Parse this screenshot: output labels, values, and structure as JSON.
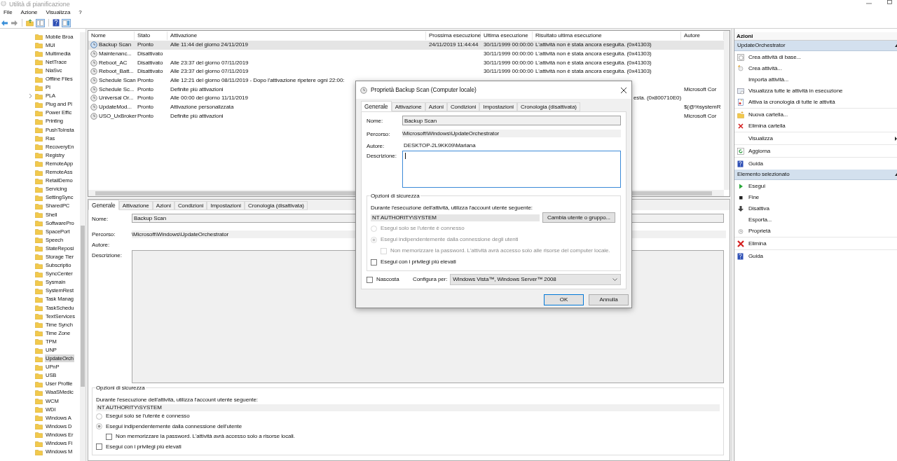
{
  "window": {
    "title": "Utilità di pianificazione"
  },
  "menu": [
    "File",
    "Azione",
    "Visualizza",
    "?"
  ],
  "tree": {
    "items": [
      {
        "label": "Mobile Broa",
        "selected": false,
        "has_children": false
      },
      {
        "label": "MUI",
        "selected": false,
        "has_children": false
      },
      {
        "label": "Multimedia",
        "selected": false,
        "has_children": false
      },
      {
        "label": "NetTrace",
        "selected": false,
        "has_children": false
      },
      {
        "label": "NlaSvc",
        "selected": false,
        "has_children": false
      },
      {
        "label": "Offline Files",
        "selected": false,
        "has_children": false
      },
      {
        "label": "PI",
        "selected": false,
        "has_children": false
      },
      {
        "label": "PLA",
        "selected": false,
        "has_children": true
      },
      {
        "label": "Plug and Pl",
        "selected": false,
        "has_children": false
      },
      {
        "label": "Power Effic",
        "selected": false,
        "has_children": false
      },
      {
        "label": "Printing",
        "selected": false,
        "has_children": false
      },
      {
        "label": "PushToInsta",
        "selected": false,
        "has_children": false
      },
      {
        "label": "Ras",
        "selected": false,
        "has_children": false
      },
      {
        "label": "RecoveryEn",
        "selected": false,
        "has_children": false
      },
      {
        "label": "Registry",
        "selected": false,
        "has_children": false
      },
      {
        "label": "RemoteApp",
        "selected": false,
        "has_children": false
      },
      {
        "label": "RemoteAss",
        "selected": false,
        "has_children": false
      },
      {
        "label": "RetailDemo",
        "selected": false,
        "has_children": false
      },
      {
        "label": "Servicing",
        "selected": false,
        "has_children": false
      },
      {
        "label": "SettingSync",
        "selected": false,
        "has_children": false
      },
      {
        "label": "SharedPC",
        "selected": false,
        "has_children": false
      },
      {
        "label": "Shell",
        "selected": false,
        "has_children": false
      },
      {
        "label": "SoftwarePro",
        "selected": false,
        "has_children": false
      },
      {
        "label": "SpacePort",
        "selected": false,
        "has_children": false
      },
      {
        "label": "Speech",
        "selected": false,
        "has_children": false
      },
      {
        "label": "StateReposi",
        "selected": false,
        "has_children": false
      },
      {
        "label": "Storage Tier",
        "selected": false,
        "has_children": false
      },
      {
        "label": "Subscriptio",
        "selected": false,
        "has_children": false
      },
      {
        "label": "SyncCenter",
        "selected": false,
        "has_children": false
      },
      {
        "label": "Sysmain",
        "selected": false,
        "has_children": false
      },
      {
        "label": "SystemRest",
        "selected": false,
        "has_children": false
      },
      {
        "label": "Task Manag",
        "selected": false,
        "has_children": false
      },
      {
        "label": "TaskSchedu",
        "selected": false,
        "has_children": false
      },
      {
        "label": "TextServices",
        "selected": false,
        "has_children": false
      },
      {
        "label": "Time Synch",
        "selected": false,
        "has_children": false
      },
      {
        "label": "Time Zone",
        "selected": false,
        "has_children": false
      },
      {
        "label": "TPM",
        "selected": false,
        "has_children": false
      },
      {
        "label": "UNP",
        "selected": false,
        "has_children": false
      },
      {
        "label": "UpdateOrch",
        "selected": true,
        "has_children": false
      },
      {
        "label": "UPnP",
        "selected": false,
        "has_children": false
      },
      {
        "label": "USB",
        "selected": false,
        "has_children": false
      },
      {
        "label": "User Profile",
        "selected": false,
        "has_children": false
      },
      {
        "label": "WaaSMedic",
        "selected": false,
        "has_children": false
      },
      {
        "label": "WCM",
        "selected": false,
        "has_children": false
      },
      {
        "label": "WDI",
        "selected": false,
        "has_children": false
      },
      {
        "label": "Windows A",
        "selected": false,
        "has_children": false
      },
      {
        "label": "Windows D",
        "selected": false,
        "has_children": false
      },
      {
        "label": "Windows Er",
        "selected": false,
        "has_children": false
      },
      {
        "label": "Windows Fi",
        "selected": false,
        "has_children": false
      },
      {
        "label": "Windows M",
        "selected": false,
        "has_children": false
      }
    ]
  },
  "task_table": {
    "columns": [
      "Nome",
      "Stato",
      "Attivazione",
      "Prossima esecuzione",
      "Ultima esecuzione",
      "Risultato ultima esecuzione",
      "Autore"
    ],
    "rows": [
      {
        "name": "Backup Scan",
        "status": "Pronto",
        "trigger": "Alle 11:44 del giorno 24/11/2019",
        "next_run": "24/11/2019 11:44:44",
        "last_run": "30/11/1999 00:00:00",
        "result": "L'attività non è stata ancora eseguita. (0x41303)",
        "selected": true
      },
      {
        "name": "Maintenanc...",
        "status": "Disattivato",
        "last_run": "30/11/1999 00:00:00",
        "result": "L'attività non è stata ancora eseguita. (0x41303)",
        "selected": false
      },
      {
        "name": "Reboot_AC",
        "status": "Disattivato",
        "trigger": "Alle 23:37 del giorno 07/11/2019",
        "last_run": "30/11/1999 00:00:00",
        "result": "L'attività non è stata ancora eseguita. (0x41303)",
        "selected": false
      },
      {
        "name": "Reboot_Batt...",
        "status": "Disattivato",
        "trigger": "Alle 23:37 del giorno 07/11/2019",
        "last_run": "30/11/1999 00:00:00",
        "result": "L'attività non è stata ancora eseguita. (0x41303)",
        "selected": false
      },
      {
        "name": "Schedule Scan",
        "status": "Pronto",
        "trigger": "Alle 12:21 del giorno 08/11/2019 - Dopo l'attivazione ripetere ogni 22:00:",
        "selected": false
      },
      {
        "name": "Schedule Sc...",
        "status": "Pronto",
        "trigger": "Definite più attivazioni",
        "author": "Microsoft Cor",
        "selected": false
      },
      {
        "name": "Universal Or...",
        "status": "Pronto",
        "trigger": "Alle 00:00 del giorno 11/11/2019",
        "result": "esta. (0x800710E0)",
        "result_clipped": true,
        "selected": false
      },
      {
        "name": "UpdateMod...",
        "status": "Pronto",
        "trigger": "Attivazione personalizzata",
        "author": "$(@%systemR",
        "selected": false
      },
      {
        "name": "USO_UxBroker",
        "status": "Pronto",
        "trigger": "Definite più attivazioni",
        "author": "Microsoft Cor",
        "selected": false
      }
    ]
  },
  "details": {
    "tabs": [
      {
        "label": "Generale",
        "selected": true
      },
      {
        "label": "Attivazione",
        "selected": false
      },
      {
        "label": "Azioni",
        "selected": false
      },
      {
        "label": "Condizioni",
        "selected": false
      },
      {
        "label": "Impostazioni",
        "selected": false
      },
      {
        "label": "Cronologia (disattivata)",
        "selected": false
      }
    ],
    "name_label": "Nome:",
    "name": "Backup Scan",
    "path_label": "Percorso:",
    "path": "\\Microsoft\\Windows\\UpdateOrchestrator",
    "author_label": "Autore:",
    "description_label": "Descrizione:",
    "security": {
      "title": "Opzioni di sicurezza",
      "account_label": "Durante l'esecuzione dell'attività, utilizza l'account utente seguente:",
      "account": "NT AUTHORITY\\SYSTEM",
      "options": [
        {
          "kind": "radio",
          "label": "Esegui solo se l'utente è connesso",
          "selected": false
        },
        {
          "kind": "radio",
          "label": "Esegui indipendentemente dalla connessione dell'utente",
          "selected": true
        },
        {
          "kind": "sub-checkbox",
          "label": "Non memorizzare la password. L'attività avrà accesso solo a risorse locali.",
          "checked": false
        },
        {
          "kind": "checkbox",
          "label": "Esegui con i privilegi più elevati",
          "checked": false
        }
      ]
    }
  },
  "dialog": {
    "title": "Proprietà Backup Scan (Computer locale)",
    "tabs": [
      {
        "label": "Generale",
        "selected": true
      },
      {
        "label": "Attivazione",
        "selected": false
      },
      {
        "label": "Azioni",
        "selected": false
      },
      {
        "label": "Condizioni",
        "selected": false
      },
      {
        "label": "Impostazioni",
        "selected": false
      },
      {
        "label": "Cronologia (disattivata)",
        "selected": false
      }
    ],
    "name_label": "Nome:",
    "name": "Backup Scan",
    "path_label": "Percorso:",
    "path": "\\Microsoft\\Windows\\UpdateOrchestrator",
    "author_label": "Autore:",
    "author": "DESKTOP-2L9KK09\\Mariana",
    "description_label": "Descrizione:",
    "security": {
      "title": "Opzioni di sicurezza",
      "account_label": "Durante l'esecuzione dell'attività, utilizza l'account utente seguente:",
      "account": "NT AUTHORITY\\SYSTEM",
      "change_button": "Cambia utente o gruppo...",
      "options": [
        {
          "kind": "radio",
          "label": "Esegui solo se l'utente è connesso",
          "selected": false,
          "disabled": true
        },
        {
          "kind": "radio",
          "label": "Esegui indipendentemente dalla connessione degli utenti",
          "selected": true,
          "disabled": true
        },
        {
          "kind": "sub-checkbox",
          "label": "Non memorizzare la password. L'attività avrà accesso solo alle risorse del computer locale.",
          "checked": false,
          "disabled": true
        },
        {
          "kind": "checkbox",
          "label": "Esegui con i privilegi più elevati",
          "checked": false,
          "disabled": false
        }
      ]
    },
    "hidden_label": "Nascosta",
    "hidden": false,
    "configure_label": "Configura per:",
    "configure_value": "Windows Vista™, Windows Server™ 2008",
    "ok": "OK",
    "cancel": "Annulla"
  },
  "actions": {
    "title": "Azioni",
    "sections": [
      {
        "title": "UpdateOrchestrator",
        "groups": [
          [
            {
              "label": "Crea attività di base...",
              "kind": "basic-task"
            },
            {
              "label": "Crea attività...",
              "kind": "new-task"
            },
            {
              "label": "Importa attività...",
              "kind": "plain"
            },
            {
              "label": "Visualizza tutte le attività in esecuzione",
              "kind": "running"
            },
            {
              "label": "Attiva la cronologia di tutte le attività",
              "kind": "history"
            }
          ],
          [
            {
              "label": "Nuova cartella...",
              "kind": "new-folder"
            },
            {
              "label": "Elimina cartella",
              "kind": "delete"
            }
          ],
          [
            {
              "label": "Visualizza",
              "kind": "submenu"
            }
          ],
          [
            {
              "label": "Aggiorna",
              "kind": "refresh"
            }
          ],
          [
            {
              "label": "Guida",
              "kind": "help"
            }
          ]
        ]
      },
      {
        "title": "Elemento selezionato",
        "groups": [
          [
            {
              "label": "Esegui",
              "kind": "run"
            },
            {
              "label": "Fine",
              "kind": "end"
            },
            {
              "label": "Disattiva",
              "kind": "disable"
            },
            {
              "label": "Esporta...",
              "kind": "plain"
            },
            {
              "label": "Proprietà",
              "kind": "properties"
            }
          ],
          [
            {
              "label": "Elimina",
              "kind": "delete-big"
            }
          ],
          [
            {
              "label": "Guida",
              "kind": "help"
            }
          ]
        ]
      }
    ]
  }
}
